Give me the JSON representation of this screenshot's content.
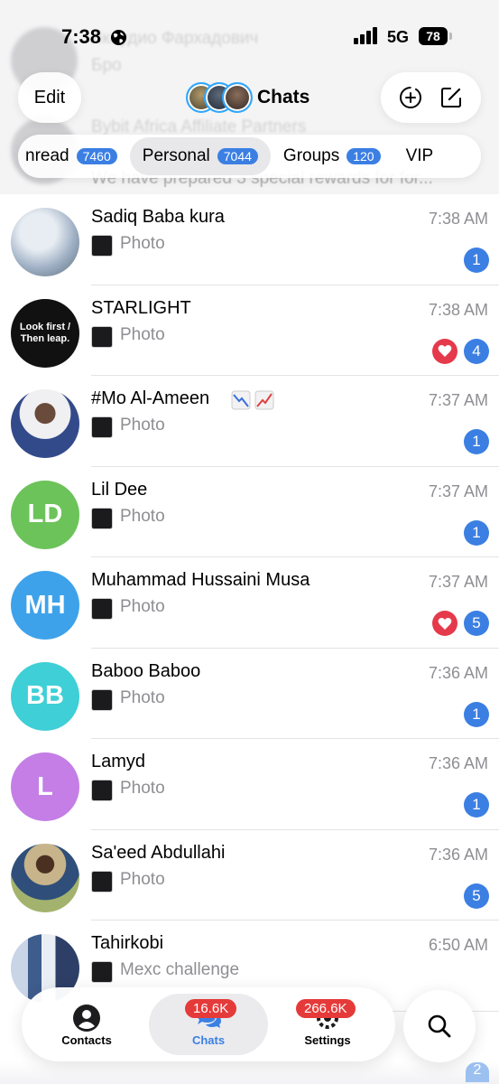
{
  "status_bar": {
    "time": "7:38",
    "network": "5G",
    "battery": "78"
  },
  "header": {
    "edit_label": "Edit",
    "title": "Chats",
    "ghost_texts": [
      "Лкаудио Фархадович",
      "Бро",
      "Bybit Africa Affiliate Partners",
      "We have prepared 3 special rewards for for..."
    ]
  },
  "folders": [
    {
      "label": "nread",
      "count": "7460",
      "active": false
    },
    {
      "label": "Personal",
      "count": "7044",
      "active": true
    },
    {
      "label": "Groups",
      "count": "120",
      "active": false
    },
    {
      "label": "VIP",
      "count": "",
      "active": false
    }
  ],
  "chats": [
    {
      "name": "Sadiq Baba kura",
      "time": "7:38 AM",
      "preview": "Photo",
      "unread": "1",
      "reaction": false,
      "avatar_initials": "",
      "avatar_color": "#b9c3cf"
    },
    {
      "name": "STARLIGHT",
      "time": "7:38 AM",
      "preview": "Photo",
      "unread": "4",
      "reaction": true,
      "avatar_initials": "",
      "avatar_color": "#111111",
      "avatar_text_line1": "Look first /",
      "avatar_text_line2": "Then leap."
    },
    {
      "name": "#Mo Al-Ameen",
      "time": "7:37 AM",
      "preview": "Photo",
      "unread": "1",
      "reaction": false,
      "avatar_initials": "",
      "avatar_color": "#dcdfe6"
    },
    {
      "name": "Lil Dee",
      "time": "7:37 AM",
      "preview": "Photo",
      "unread": "1",
      "reaction": false,
      "avatar_initials": "LD",
      "avatar_color": "#6cc35a"
    },
    {
      "name": "Muhammad Hussaini Musa",
      "time": "7:37 AM",
      "preview": "Photo",
      "unread": "5",
      "reaction": true,
      "avatar_initials": "MH",
      "avatar_color": "#3ea2ea"
    },
    {
      "name": "Baboo Baboo",
      "time": "7:36 AM",
      "preview": "Photo",
      "unread": "1",
      "reaction": false,
      "avatar_initials": "BB",
      "avatar_color": "#3fcfd6"
    },
    {
      "name": "Lamyd",
      "time": "7:36 AM",
      "preview": "Photo",
      "unread": "1",
      "reaction": false,
      "avatar_initials": "L",
      "avatar_color": "#c47ee6"
    },
    {
      "name": "Sa'eed Abdullahi",
      "time": "7:36 AM",
      "preview": "Photo",
      "unread": "5",
      "reaction": false,
      "avatar_initials": "",
      "avatar_color": "#8a9a6e"
    },
    {
      "name": "Tahirkobi",
      "time": "6:50 AM",
      "preview": "Mexc challenge",
      "unread": "",
      "reaction": false,
      "avatar_initials": "",
      "avatar_color": "#7a8fb0"
    }
  ],
  "tab_bar": {
    "contacts_label": "Contacts",
    "chats_label": "Chats",
    "chats_badge": "16.6K",
    "settings_label": "Settings",
    "settings_badge": "266.6K"
  },
  "peek_badge": "2",
  "icons": {
    "globe": "globe-icon",
    "signal": "signal-icon",
    "add_story": "add-story-icon",
    "compose": "compose-icon",
    "contacts": "person-circle-icon",
    "chats": "chat-bubbles-icon",
    "settings": "gear-icon",
    "search": "search-icon",
    "reaction": "heart-icon"
  },
  "colors": {
    "accent": "#3b7fe3",
    "reaction": "#e53a4b",
    "badge_red": "#e53a3a",
    "secondary_text": "#8e8e93"
  }
}
